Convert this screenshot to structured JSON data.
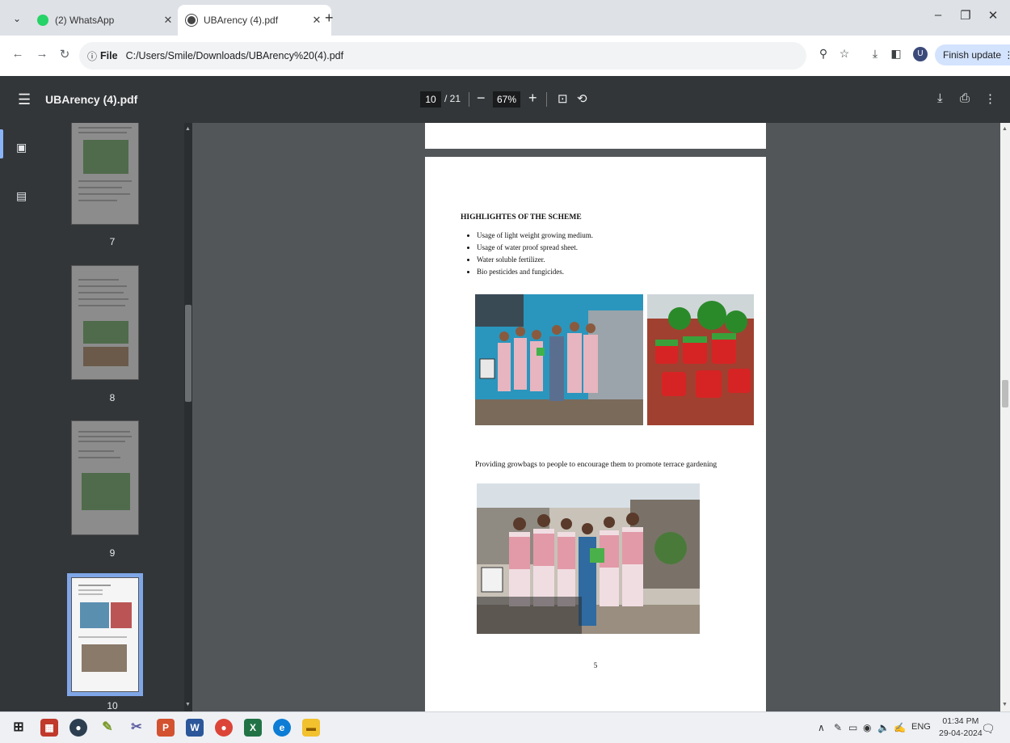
{
  "browser": {
    "tabs": [
      {
        "title": "(2) WhatsApp",
        "icon": "whatsapp-icon",
        "active": false
      },
      {
        "title": "UBArency (4).pdf",
        "icon": "globe-icon",
        "active": true
      }
    ],
    "address": {
      "scheme_label": "File",
      "url": "C:/Users/Smile/Downloads/UBArency%20(4).pdf"
    },
    "profile_initial": "U",
    "finish_update_label": "Finish update"
  },
  "pdf_toolbar": {
    "title": "UBArency (4).pdf",
    "current_page": "10",
    "total_pages": "/ 21",
    "zoom": "67%"
  },
  "thumbnails": [
    {
      "label": "7"
    },
    {
      "label": "8"
    },
    {
      "label": "9"
    },
    {
      "label": "10"
    }
  ],
  "document": {
    "heading": "HIGHLIGHTES OF THE SCHEME",
    "bullets": [
      "Usage of light weight growing medium.",
      "Usage of water proof spread sheet.",
      "Water soluble fertilizer.",
      "Bio pesticides and fungicides."
    ],
    "caption": "Providing growbags to people to encourage them to promote terrace gardening",
    "page_number": "5"
  },
  "taskbar": {
    "language": "ENG",
    "time": "01:34 PM",
    "date": "29-04-2024"
  },
  "colors": {
    "pdf_toolbar_bg": "#323639",
    "viewer_bg": "#525659",
    "accent": "#8ab4f8"
  }
}
